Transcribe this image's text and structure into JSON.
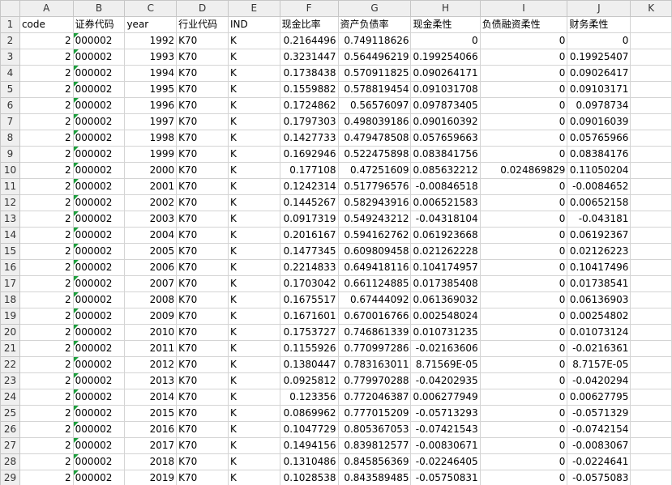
{
  "column_letters": [
    "A",
    "B",
    "C",
    "D",
    "E",
    "F",
    "G",
    "H",
    "I",
    "J",
    "K"
  ],
  "header_row": {
    "row_number": "1",
    "cells": [
      "code",
      "证券代码",
      "year",
      "行业代码",
      "IND",
      "现金比率",
      "资产负债率",
      "现金柔性",
      "负债融资柔性",
      "财务柔性",
      ""
    ]
  },
  "rows": [
    {
      "row_number": "2",
      "cells": [
        "2",
        "000002",
        "1992",
        "K70",
        "K",
        "0.2164496",
        "0.749118626",
        "0",
        "0",
        "0",
        ""
      ]
    },
    {
      "row_number": "3",
      "cells": [
        "2",
        "000002",
        "1993",
        "K70",
        "K",
        "0.3231447",
        "0.564496219",
        "0.199254066",
        "0",
        "0.19925407",
        ""
      ]
    },
    {
      "row_number": "4",
      "cells": [
        "2",
        "000002",
        "1994",
        "K70",
        "K",
        "0.1738438",
        "0.570911825",
        "0.090264171",
        "0",
        "0.09026417",
        ""
      ]
    },
    {
      "row_number": "5",
      "cells": [
        "2",
        "000002",
        "1995",
        "K70",
        "K",
        "0.1559882",
        "0.578819454",
        "0.091031708",
        "0",
        "0.09103171",
        ""
      ]
    },
    {
      "row_number": "6",
      "cells": [
        "2",
        "000002",
        "1996",
        "K70",
        "K",
        "0.1724862",
        "0.56576097",
        "0.097873405",
        "0",
        "0.0978734",
        ""
      ]
    },
    {
      "row_number": "7",
      "cells": [
        "2",
        "000002",
        "1997",
        "K70",
        "K",
        "0.1797303",
        "0.498039186",
        "0.090160392",
        "0",
        "0.09016039",
        ""
      ]
    },
    {
      "row_number": "8",
      "cells": [
        "2",
        "000002",
        "1998",
        "K70",
        "K",
        "0.1427733",
        "0.479478508",
        "0.057659663",
        "0",
        "0.05765966",
        ""
      ]
    },
    {
      "row_number": "9",
      "cells": [
        "2",
        "000002",
        "1999",
        "K70",
        "K",
        "0.1692946",
        "0.522475898",
        "0.083841756",
        "0",
        "0.08384176",
        ""
      ]
    },
    {
      "row_number": "10",
      "cells": [
        "2",
        "000002",
        "2000",
        "K70",
        "K",
        "0.177108",
        "0.47251609",
        "0.085632212",
        "0.024869829",
        "0.11050204",
        ""
      ]
    },
    {
      "row_number": "11",
      "cells": [
        "2",
        "000002",
        "2001",
        "K70",
        "K",
        "0.1242314",
        "0.517796576",
        "-0.00846518",
        "0",
        "-0.0084652",
        ""
      ]
    },
    {
      "row_number": "12",
      "cells": [
        "2",
        "000002",
        "2002",
        "K70",
        "K",
        "0.1445267",
        "0.582943916",
        "0.006521583",
        "0",
        "0.00652158",
        ""
      ]
    },
    {
      "row_number": "13",
      "cells": [
        "2",
        "000002",
        "2003",
        "K70",
        "K",
        "0.0917319",
        "0.549243212",
        "-0.04318104",
        "0",
        "-0.043181",
        ""
      ]
    },
    {
      "row_number": "14",
      "cells": [
        "2",
        "000002",
        "2004",
        "K70",
        "K",
        "0.2016167",
        "0.594162762",
        "0.061923668",
        "0",
        "0.06192367",
        ""
      ]
    },
    {
      "row_number": "15",
      "cells": [
        "2",
        "000002",
        "2005",
        "K70",
        "K",
        "0.1477345",
        "0.609809458",
        "0.021262228",
        "0",
        "0.02126223",
        ""
      ]
    },
    {
      "row_number": "16",
      "cells": [
        "2",
        "000002",
        "2006",
        "K70",
        "K",
        "0.2214833",
        "0.649418116",
        "0.104174957",
        "0",
        "0.10417496",
        ""
      ]
    },
    {
      "row_number": "17",
      "cells": [
        "2",
        "000002",
        "2007",
        "K70",
        "K",
        "0.1703042",
        "0.661124885",
        "0.017385408",
        "0",
        "0.01738541",
        ""
      ]
    },
    {
      "row_number": "18",
      "cells": [
        "2",
        "000002",
        "2008",
        "K70",
        "K",
        "0.1675517",
        "0.67444092",
        "0.061369032",
        "0",
        "0.06136903",
        ""
      ]
    },
    {
      "row_number": "19",
      "cells": [
        "2",
        "000002",
        "2009",
        "K70",
        "K",
        "0.1671601",
        "0.670016766",
        "0.002548024",
        "0",
        "0.00254802",
        ""
      ]
    },
    {
      "row_number": "20",
      "cells": [
        "2",
        "000002",
        "2010",
        "K70",
        "K",
        "0.1753727",
        "0.746861339",
        "0.010731235",
        "0",
        "0.01073124",
        ""
      ]
    },
    {
      "row_number": "21",
      "cells": [
        "2",
        "000002",
        "2011",
        "K70",
        "K",
        "0.1155926",
        "0.770997286",
        "-0.02163606",
        "0",
        "-0.0216361",
        ""
      ]
    },
    {
      "row_number": "22",
      "cells": [
        "2",
        "000002",
        "2012",
        "K70",
        "K",
        "0.1380447",
        "0.783163011",
        "8.71569E-05",
        "0",
        "8.7157E-05",
        ""
      ]
    },
    {
      "row_number": "23",
      "cells": [
        "2",
        "000002",
        "2013",
        "K70",
        "K",
        "0.0925812",
        "0.779970288",
        "-0.04202935",
        "0",
        "-0.0420294",
        ""
      ]
    },
    {
      "row_number": "24",
      "cells": [
        "2",
        "000002",
        "2014",
        "K70",
        "K",
        "0.123356",
        "0.772046387",
        "0.006277949",
        "0",
        "0.00627795",
        ""
      ]
    },
    {
      "row_number": "25",
      "cells": [
        "2",
        "000002",
        "2015",
        "K70",
        "K",
        "0.0869962",
        "0.777015209",
        "-0.05713293",
        "0",
        "-0.0571329",
        ""
      ]
    },
    {
      "row_number": "26",
      "cells": [
        "2",
        "000002",
        "2016",
        "K70",
        "K",
        "0.1047729",
        "0.805367053",
        "-0.07421543",
        "0",
        "-0.0742154",
        ""
      ]
    },
    {
      "row_number": "27",
      "cells": [
        "2",
        "000002",
        "2017",
        "K70",
        "K",
        "0.1494156",
        "0.839812577",
        "-0.00830671",
        "0",
        "-0.0083067",
        ""
      ]
    },
    {
      "row_number": "28",
      "cells": [
        "2",
        "000002",
        "2018",
        "K70",
        "K",
        "0.1310486",
        "0.845856369",
        "-0.02246405",
        "0",
        "-0.0224641",
        ""
      ]
    },
    {
      "row_number": "29",
      "cells": [
        "2",
        "000002",
        "2019",
        "K70",
        "K",
        "0.1028538",
        "0.843589485",
        "-0.05750831",
        "0",
        "-0.0575083",
        ""
      ]
    }
  ],
  "text_number_indicator_color": "#1e9f3e"
}
